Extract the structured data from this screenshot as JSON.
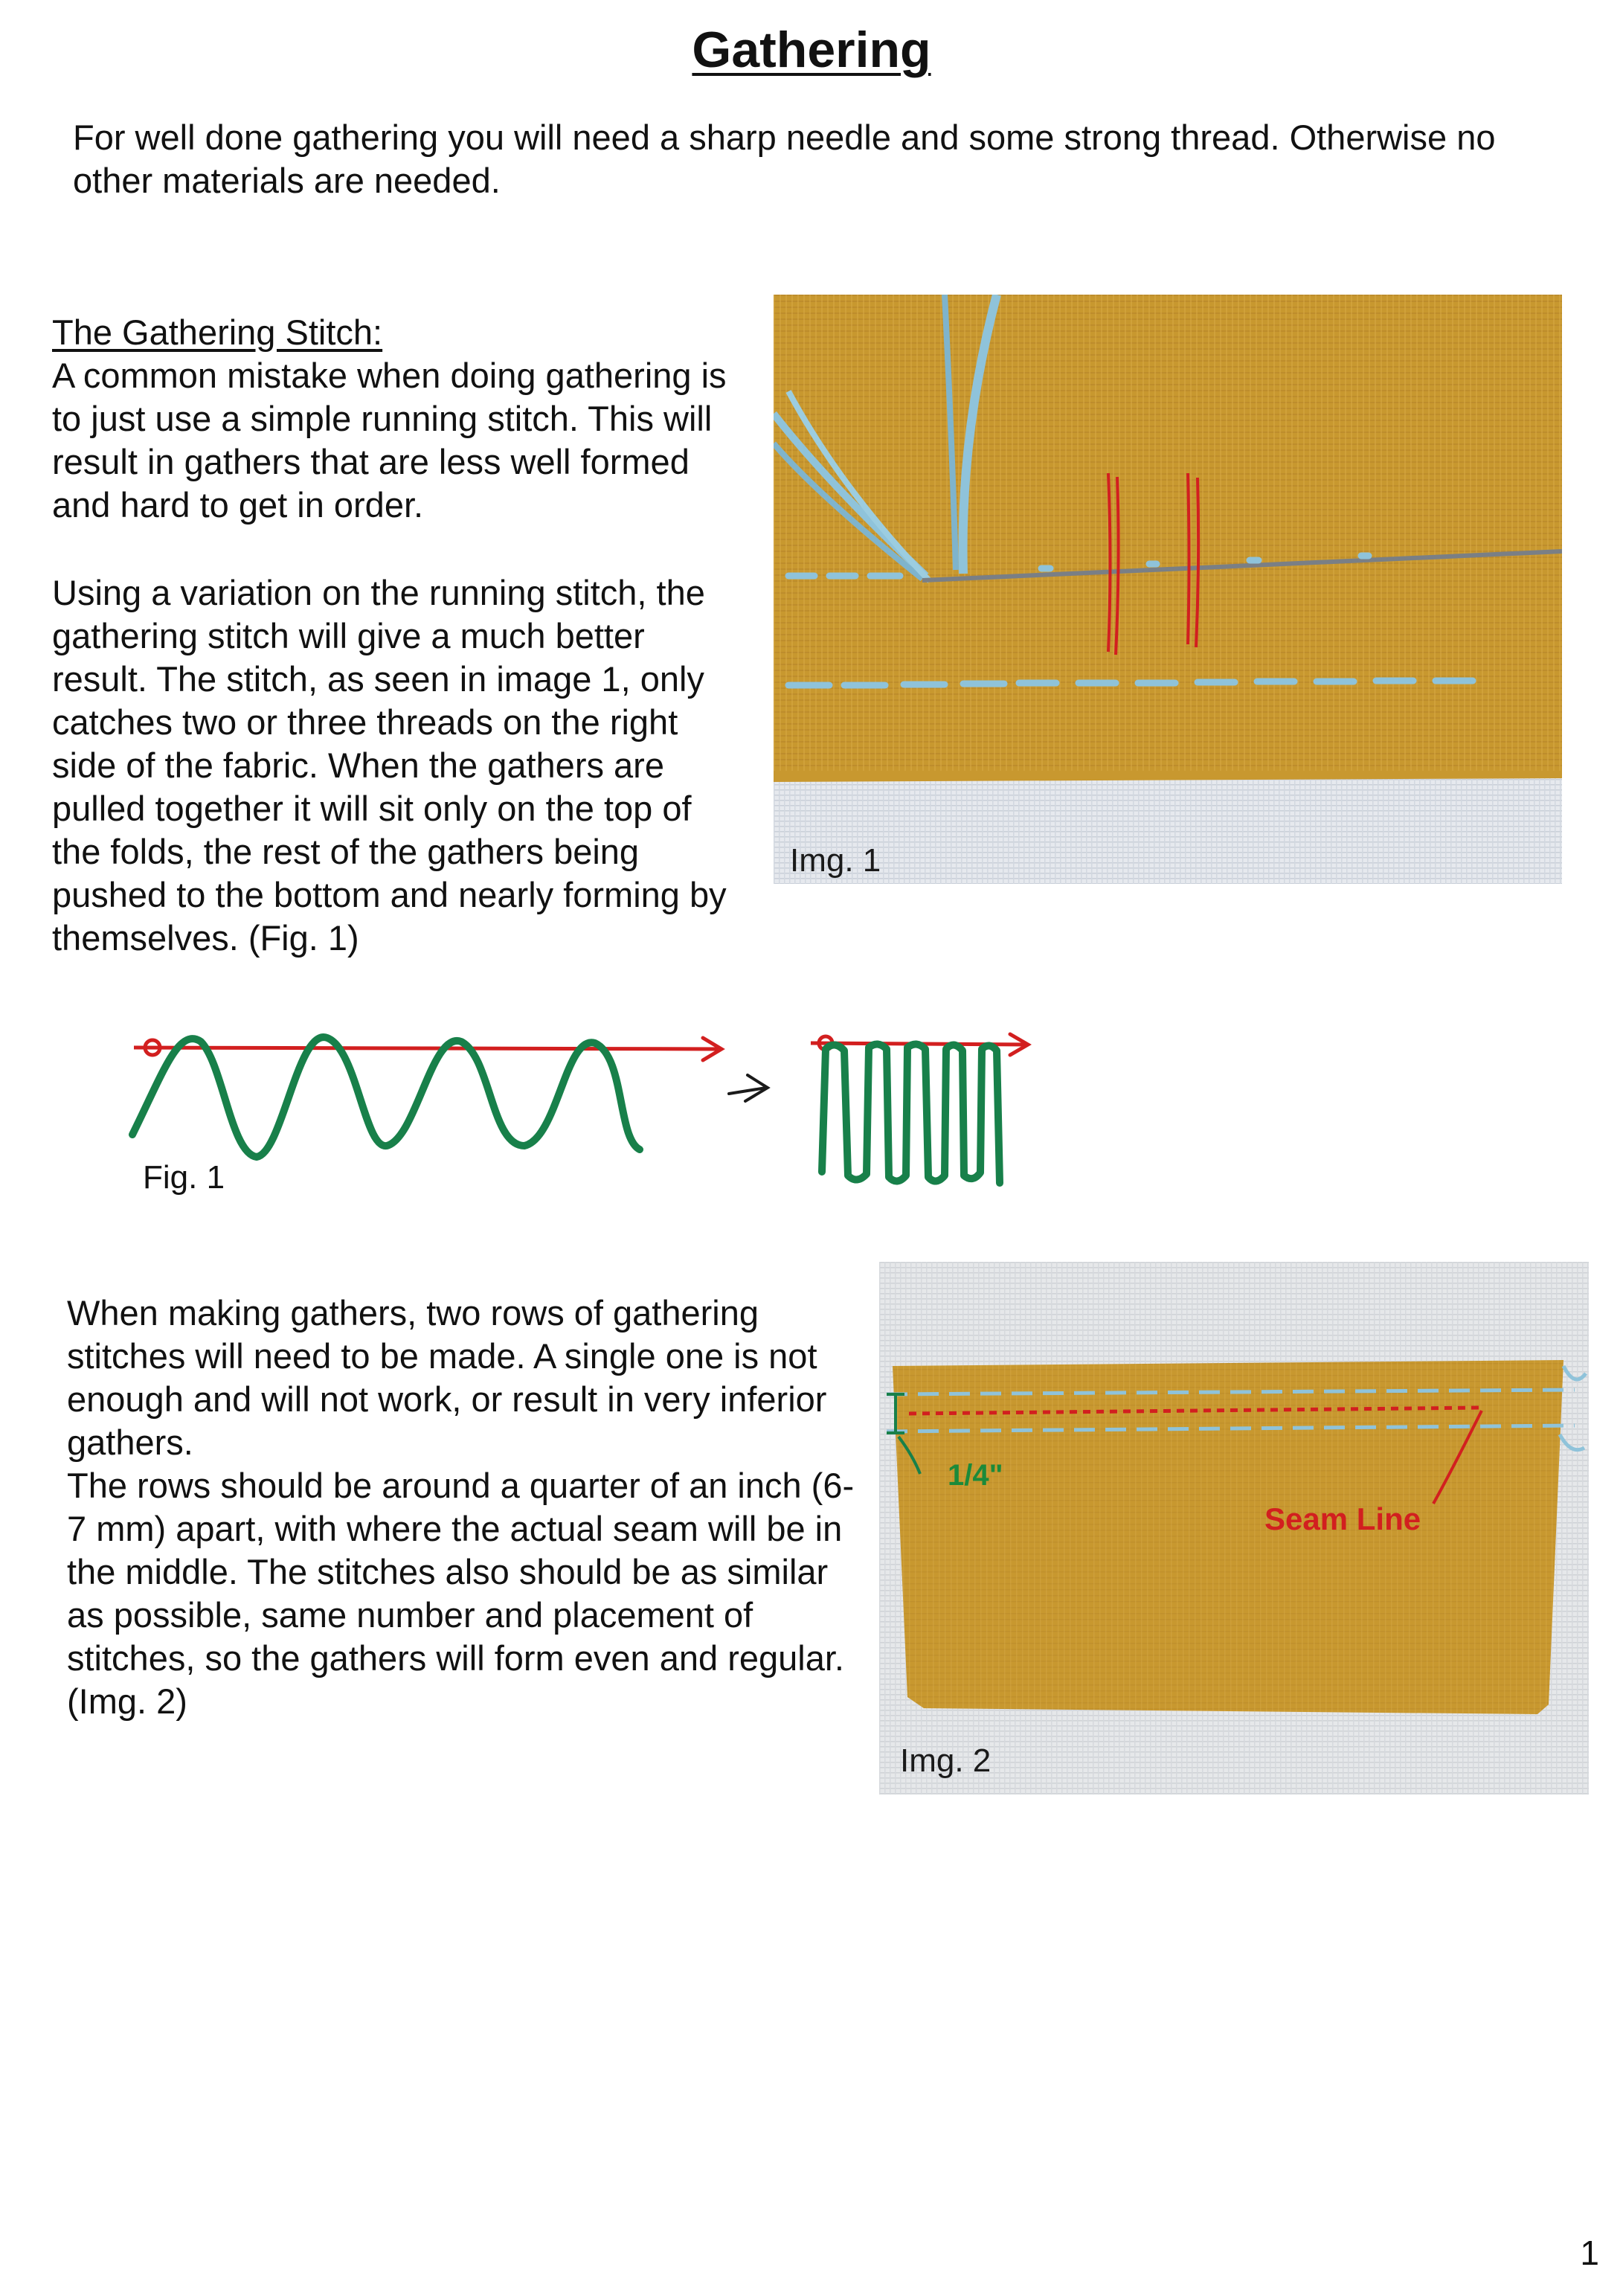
{
  "title": "Gathering",
  "intro": "For well done gathering you will need a sharp needle and some strong thread. Otherwise no other materials are needed.",
  "gathering_stitch": {
    "heading": "The Gathering Stitch:",
    "p1": "A common mistake when doing gathering is to just use a simple running stitch. This will result in gathers that are less well formed and hard to get in order.",
    "p2": "Using a variation on the running stitch, the gathering stitch will give a much better result. The stitch, as seen in image 1, only catches two or three threads on the right side of the fabric. When the gathers are pulled together it will sit only on the top of the folds, the rest of the gathers being pushed to the bottom and nearly forming by themselves. (Fig. 1)"
  },
  "img1": {
    "caption": "Img. 1"
  },
  "fig1": {
    "caption": "Fig. 1",
    "arrow_glyph": "→"
  },
  "section2": {
    "p": "When making gathers, two rows of gathering stitches will need to  be made. A single one is not enough and will not work, or result in very inferior gathers.\nThe rows should be around a quarter of an inch (6-7 mm) apart, with where the actual seam will be in the middle. The stitches also should be as similar as possible, same number and placement of stitches, so the gathers will form even and regular. (Img. 2)"
  },
  "img2": {
    "caption": "Img. 2",
    "label_quarter": "1/4\"",
    "label_seam": "Seam Line"
  },
  "page_number": "1",
  "colors": {
    "fabric_mustard": "#c8982f",
    "fabric_white": "#e9ecef",
    "thread_blue": "#8fc3da",
    "marker_red": "#d21f1f",
    "marker_green": "#18804a",
    "label_green": "#1c8a3a"
  }
}
